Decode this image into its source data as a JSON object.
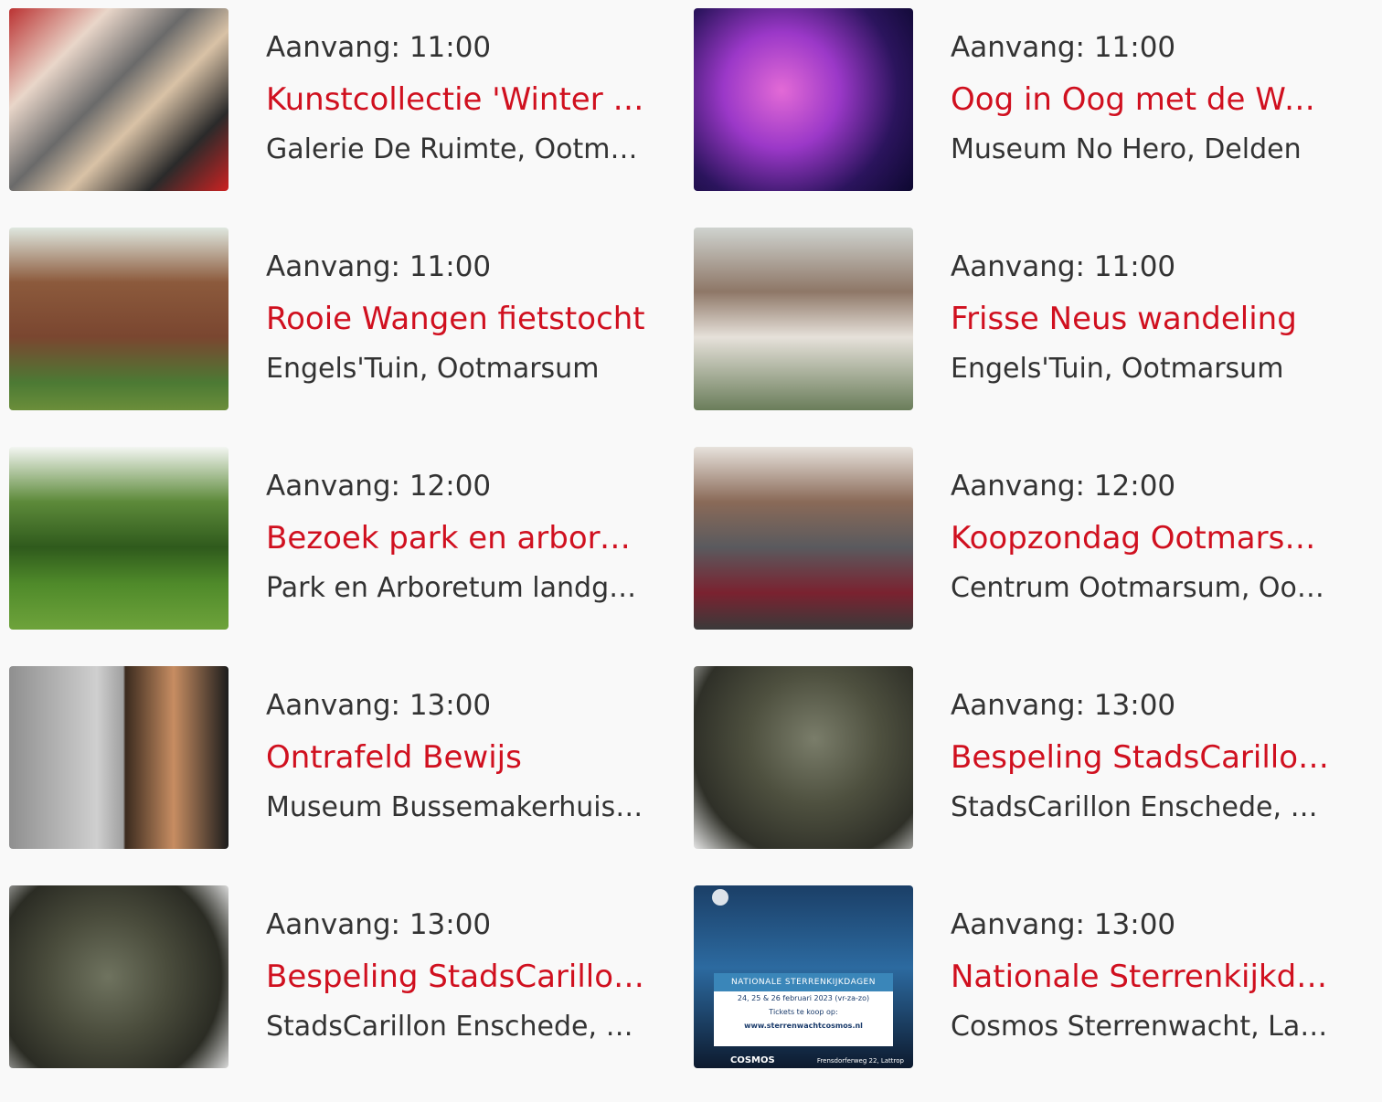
{
  "events": [
    {
      "time": "Aanvang: 11:00",
      "title": "Kunstcollectie 'Winter …",
      "location": "Galerie De Ruimte, Ootma…",
      "image": "art-collage-thumbnail"
    },
    {
      "time": "Aanvang: 11:00",
      "title": "Oog in Oog met de Wer…",
      "location": "Museum No Hero, Delden",
      "image": "two-figures-sculpture-thumbnail"
    },
    {
      "time": "Aanvang: 11:00",
      "title": "Rooie Wangen fietstocht",
      "location": "Engels'Tuin, Ootmarsum",
      "image": "brick-house-cyclists-thumbnail"
    },
    {
      "time": "Aanvang: 11:00",
      "title": "Frisse Neus wandeling",
      "location": "Engels'Tuin, Ootmarsum",
      "image": "couple-with-map-thumbnail"
    },
    {
      "time": "Aanvang: 12:00",
      "title": "Bezoek park en arbore…",
      "location": "Park en Arboretum landg…",
      "image": "park-lawn-thumbnail"
    },
    {
      "time": "Aanvang: 12:00",
      "title": "Koopzondag Ootmarsum",
      "location": "Centrum Ootmarsum, Oot…",
      "image": "shopping-woman-thumbnail"
    },
    {
      "time": "Aanvang: 13:00",
      "title": "Ontrafeld Bewijs",
      "location": "Museum Bussemakerhuis, …",
      "image": "portrait-xray-thumbnail"
    },
    {
      "time": "Aanvang: 13:00",
      "title": "Bespeling StadsCarillo…",
      "location": "StadsCarillon Enschede, E…",
      "image": "carillon-bells-thumbnail"
    },
    {
      "time": "Aanvang: 13:00",
      "title": "Bespeling StadsCarillo…",
      "location": "StadsCarillon Enschede, E…",
      "image": "carillon-bells-thumbnail"
    },
    {
      "time": "Aanvang: 13:00",
      "title": "Nationale Sterrenkijkd…",
      "location": "Cosmos Sterrenwacht, Lat…",
      "image": "stargazing-poster-thumbnail"
    }
  ],
  "poster": {
    "band": "NATIONALE STERRENKIJKDAGEN",
    "dates": "24, 25 & 26 februari 2023  (vr-za-zo)",
    "tickets": "Tickets te koop op:",
    "url": "www.sterrenwachtcosmos.nl",
    "brand": "COSMOS",
    "address": "Frensdorferweg 22, Lattrop"
  },
  "colors": {
    "title": "#d0101f",
    "text": "#333333",
    "background": "#f9f9f9"
  }
}
